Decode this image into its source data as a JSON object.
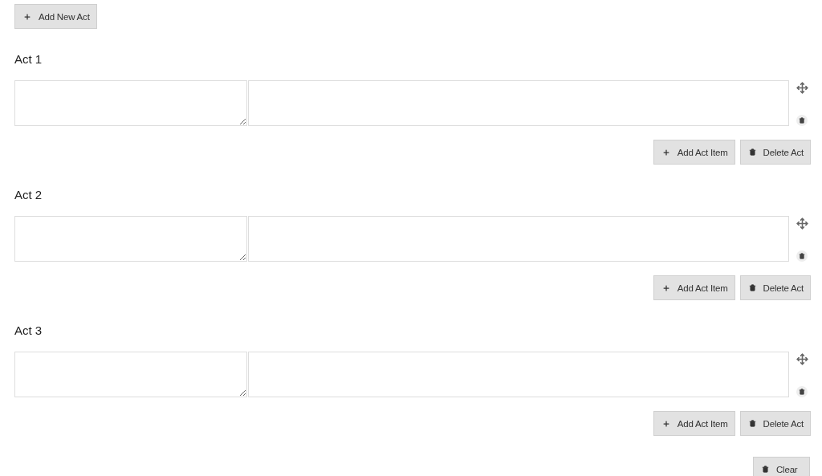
{
  "add_button": {
    "label": "Add New Act"
  },
  "acts": [
    {
      "title": "Act 1",
      "add_item_label": "Add Act Item",
      "delete_label": "Delete Act"
    },
    {
      "title": "Act 2",
      "add_item_label": "Add Act Item",
      "delete_label": "Delete Act"
    },
    {
      "title": "Act 3",
      "add_item_label": "Add Act Item",
      "delete_label": "Delete Act"
    }
  ],
  "clear_button": {
    "label": "Clear"
  }
}
